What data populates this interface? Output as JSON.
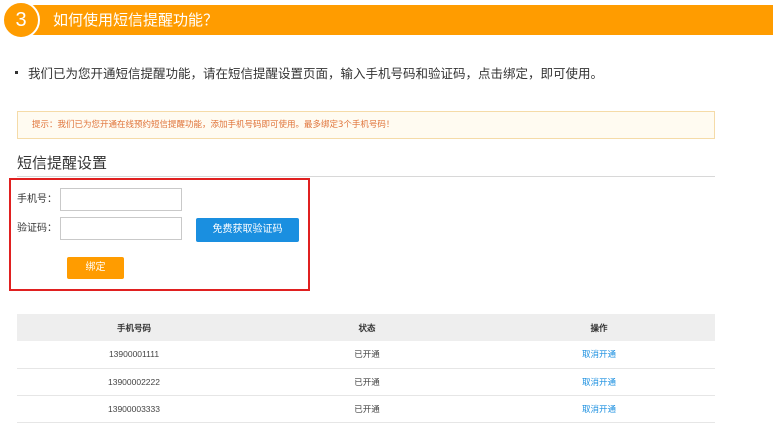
{
  "step": {
    "number": "3",
    "title": "如何使用短信提醒功能？"
  },
  "intro": "我们已为您开通短信提醒功能，请在短信提醒设置页面，输入手机号码和验证码，点击绑定，即可使用。",
  "tip": "提示：我们已为您开通在线预约短信提醒功能，添加手机号码即可使用。最多绑定3个手机号码！",
  "section_title": "短信提醒设置",
  "form": {
    "phone_label": "手机号：",
    "phone_value": "",
    "code_label": "验证码：",
    "code_value": "",
    "get_code_button": "免费获取验证码",
    "bind_button": "绑定"
  },
  "table": {
    "headers": [
      "手机号码",
      "状态",
      "操作"
    ],
    "rows": [
      {
        "phone": "13900001111",
        "status": "已开通",
        "action": "取消开通"
      },
      {
        "phone": "13900002222",
        "status": "已开通",
        "action": "取消开通"
      },
      {
        "phone": "13900003333",
        "status": "已开通",
        "action": "取消开通"
      }
    ]
  },
  "colors": {
    "accent_orange": "#ff9c00",
    "button_blue": "#1a8fe0",
    "highlight_red": "#e02020",
    "tip_text": "#e0743a"
  }
}
